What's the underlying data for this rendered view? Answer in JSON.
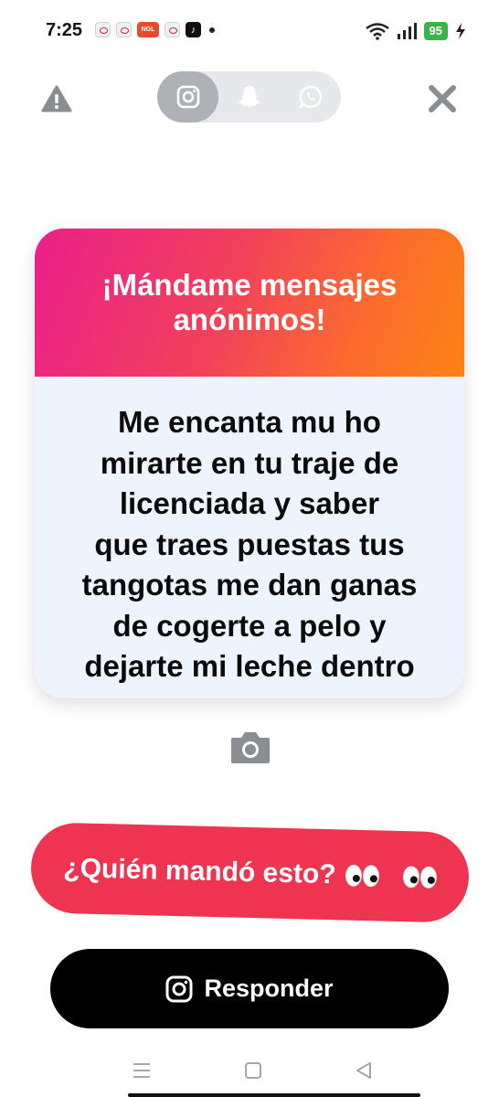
{
  "status_bar": {
    "time": "7:25",
    "battery": "95",
    "ngl_label": "NGL",
    "notification_icons": [
      "eye-app-icon",
      "eye-app-icon",
      "ngl-app-icon",
      "eye-app-icon",
      "tiktok-icon",
      "dot-icon"
    ],
    "system_icons": [
      "wifi-icon",
      "signal-icon",
      "battery-icon",
      "charging-icon"
    ]
  },
  "top_bar": {
    "share_options": [
      "instagram-icon",
      "snapchat-icon",
      "whatsapp-icon"
    ],
    "active_option": "instagram-icon",
    "left_icon": "warning-icon",
    "right_icon": "close-icon"
  },
  "card": {
    "title": "¡Mándame mensajes anónimos!",
    "message_lines": [
      "Me encanta mu ho",
      "mirarte en tu traje de",
      "licenciada y saber",
      "que traes puestas tus",
      "tangotas me dan ganas",
      "de cogerte a pelo y",
      "dejarte mi leche dentro"
    ]
  },
  "camera_icon": "camera-icon",
  "who_button": {
    "label": "¿Quién mandó esto?",
    "emoji": "eyes-emoji"
  },
  "reply_button": {
    "label": "Responder",
    "icon": "instagram-icon"
  },
  "nav_bar": {
    "items": [
      "menu-icon",
      "home-square-icon",
      "back-triangle-icon"
    ]
  },
  "colors": {
    "gradient_start": "#e9208a",
    "gradient_end": "#fd8214",
    "card_body": "#eef4fd",
    "who_button": "#ef3452",
    "reply_button": "#000000",
    "toggle_bg": "#e6e8eb",
    "toggle_active": "#aeb2b7"
  }
}
